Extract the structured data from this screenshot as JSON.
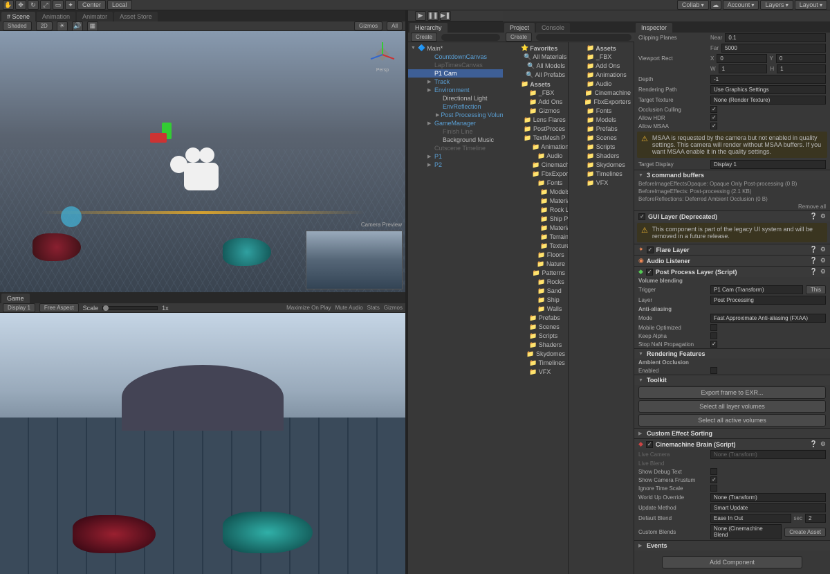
{
  "topbar": {
    "center": "Center",
    "local": "Local",
    "collab": "Collab",
    "account": "Account",
    "layers": "Layers",
    "layout": "Layout"
  },
  "tabs": {
    "scene": "# Scene",
    "animation": "Animation",
    "animator": "Animator",
    "assetstore": "Asset Store",
    "game": "Game"
  },
  "sceneBar": {
    "shaded": "Shaded",
    "mode2d": "2D",
    "gizmos": "Gizmos",
    "all": "All",
    "persp": "Persp"
  },
  "gameBar": {
    "display": "Display 1",
    "aspect": "Free Aspect",
    "scale": "Scale",
    "scaleVal": "1x",
    "maxplay": "Maximize On Play",
    "mute": "Mute Audio",
    "stats": "Stats",
    "gizmos": "Gizmos"
  },
  "camPreview": "Camera Preview",
  "hierarchyTab": "Hierarchy",
  "hierarchyBar": {
    "create": "Create"
  },
  "hierarchy": {
    "root": "Main*",
    "items": [
      {
        "label": "CountdownCanvas",
        "link": true,
        "i": 2
      },
      {
        "label": "LapTimesCanvas",
        "link": true,
        "dim": true,
        "i": 2
      },
      {
        "label": "P1 Cam",
        "selected": true,
        "i": 2
      },
      {
        "label": "Track",
        "link": true,
        "arrow": true,
        "i": 2
      },
      {
        "label": "Environment",
        "link": true,
        "arrow": true,
        "i": 2
      },
      {
        "label": "Directional Light",
        "i": 3
      },
      {
        "label": "EnvReflection",
        "link": true,
        "i": 3
      },
      {
        "label": "Post Processing Volumes",
        "link": true,
        "arrow": true,
        "i": 3
      },
      {
        "label": "GameManager",
        "link": true,
        "arrow": true,
        "i": 2
      },
      {
        "label": "Finish Line",
        "dim": true,
        "i": 3
      },
      {
        "label": "Background Music",
        "i": 3
      },
      {
        "label": "Cutscene Timeline",
        "link": true,
        "dim": true,
        "i": 2
      },
      {
        "label": "P1",
        "link": true,
        "arrow": true,
        "i": 2
      },
      {
        "label": "P2",
        "link": true,
        "arrow": true,
        "i": 2
      }
    ]
  },
  "projectTab": "Project",
  "consoleTab": "Console",
  "projBar": {
    "create": "Create"
  },
  "project": {
    "favorites": "Favorites",
    "fav": [
      "All Materials",
      "All Models",
      "All Prefabs"
    ],
    "assetsRoot": "Assets",
    "col1": [
      "_FBX",
      "Add Ons",
      "Gizmos",
      "Lens Flares",
      "PostProces",
      "TextMesh P",
      "Animations",
      "Audio",
      "Cinemachine",
      "FbxExporters",
      "Fonts",
      "Models",
      "Materials",
      "Rock LODs",
      "Ship Parts",
      "Material-",
      "Terrains",
      "Textures",
      "Floors",
      "Nature",
      "Patterns",
      "Rocks",
      "Sand",
      "Ship",
      "Walls",
      "Prefabs",
      "Scenes",
      "Scripts",
      "Shaders",
      "Skydomes",
      "Timelines",
      "VFX"
    ],
    "col2hdr": "Assets",
    "col2": [
      "_FBX",
      "Add Ons",
      "Animations",
      "Audio",
      "Cinemachine",
      "FbxExporters",
      "Fonts",
      "Models",
      "Prefabs",
      "Scenes",
      "Scripts",
      "Shaders",
      "Skydomes",
      "Timelines",
      "VFX"
    ]
  },
  "inspector": {
    "tab": "Inspector",
    "clipping": "Clipping Planes",
    "near": "Near",
    "nearV": "0.1",
    "far": "Far",
    "farV": "5000",
    "viewport": "Viewport Rect",
    "x": "X",
    "xv": "0",
    "y": "Y",
    "yv": "0",
    "w": "W",
    "wv": "1",
    "h": "H",
    "hv": "1",
    "depth": "Depth",
    "depthV": "-1",
    "renderPath": "Rendering Path",
    "renderPathV": "Use Graphics Settings",
    "targetTex": "Target Texture",
    "targetTexV": "None (Render Texture)",
    "occl": "Occlusion Culling",
    "hdr": "Allow HDR",
    "msaa": "Allow MSAA",
    "msaaWarn": "MSAA is requested by the camera but not enabled in quality settings. This camera will render without MSAA buffers. If you want MSAA enable it in the quality settings.",
    "targetDisp": "Target Display",
    "targetDispV": "Display 1",
    "cmdBuf": "3 command buffers",
    "cmd1": "BeforeImageEffectsOpaque: Opaque Only Post-processing (0 B)",
    "cmd2": "BeforeImageEffects: Post-processing (2.1 KB)",
    "cmd3": "BeforeReflections: Deferred Ambient Occlusion (0 B)",
    "removeAll": "Remove all",
    "guiLayer": "GUI Layer (Deprecated)",
    "guiWarn": "This component is part of the legacy UI system and will be removed in a future release.",
    "flare": "Flare Layer",
    "audio": "Audio Listener",
    "ppl": "Post Process Layer (Script)",
    "volBlend": "Volume blending",
    "trigger": "Trigger",
    "triggerV": "P1 Cam (Transform)",
    "this": "This",
    "layer": "Layer",
    "layerV": "Post Processing",
    "aa": "Anti-aliasing",
    "mode": "Mode",
    "modeV": "Fast Approximate Anti-aliasing (FXAA)",
    "mobOpt": "Mobile Optimized",
    "keepAlpha": "Keep Alpha",
    "stopNan": "Stop NaN Propagation",
    "rendFeat": "Rendering Features",
    "ao": "Ambient Occlusion",
    "enabled": "Enabled",
    "toolkit": "Toolkit",
    "exportExr": "Export frame to EXR...",
    "selLayer": "Select all layer volumes",
    "selActive": "Select all active volumes",
    "customSort": "Custom Effect Sorting",
    "cineBrain": "Cinemachine Brain (Script)",
    "liveCam": "Live Camera",
    "liveCamV": "None (Transform)",
    "liveBlend": "Live Blend",
    "showDebug": "Show Debug Text",
    "showFrustum": "Show Camera Frustum",
    "ignoreTime": "Ignore Time Scale",
    "worldUp": "World Up Override",
    "worldUpV": "None (Transform)",
    "updateMeth": "Update Method",
    "updateMethV": "Smart Update",
    "defBlend": "Default Blend",
    "defBlendV": "Ease In Out",
    "sec": "sec",
    "secV": "2",
    "custBlends": "Custom Blends",
    "custBlendsV": "None (Cinemachine Blend",
    "createAsset": "Create Asset",
    "events": "Events",
    "addComp": "Add Component"
  }
}
